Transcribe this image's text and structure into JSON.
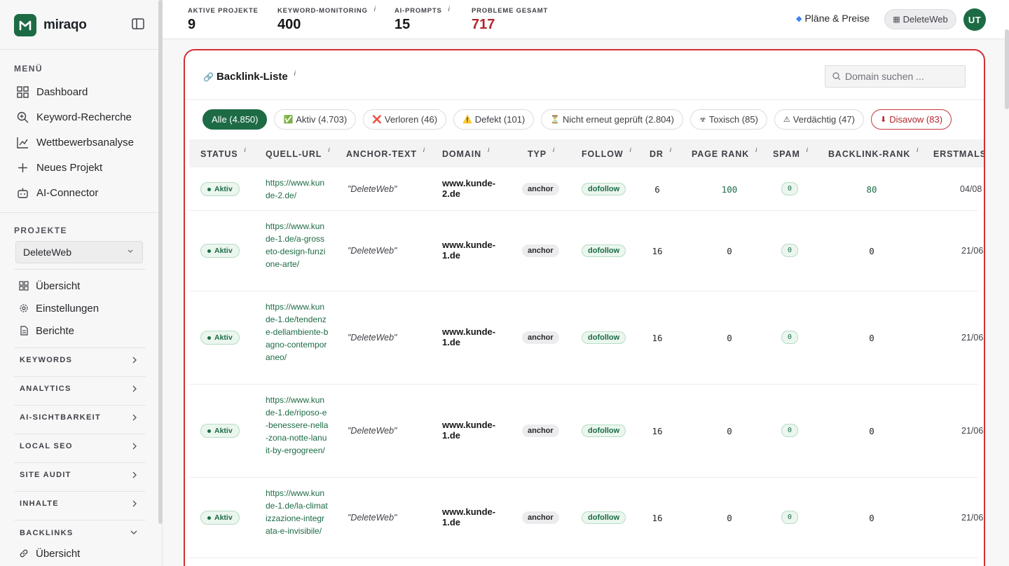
{
  "brand": {
    "name": "miraqo"
  },
  "sidebar": {
    "menu_heading": "MENÜ",
    "menu_items": [
      {
        "label": "Dashboard",
        "icon": "grid-icon"
      },
      {
        "label": "Keyword-Recherche",
        "icon": "search-plus-icon"
      },
      {
        "label": "Wettbewerbsanalyse",
        "icon": "chart-line-icon"
      },
      {
        "label": "Neues Projekt",
        "icon": "plus-icon"
      },
      {
        "label": "AI-Connector",
        "icon": "robot-icon"
      }
    ],
    "projects_heading": "PROJEKTE",
    "project_select": "DeleteWeb",
    "project_items": [
      {
        "label": "Übersicht",
        "icon": "grid-icon"
      },
      {
        "label": "Einstellungen",
        "icon": "gear-icon"
      },
      {
        "label": "Berichte",
        "icon": "document-icon"
      }
    ],
    "groups": [
      "KEYWORDS",
      "ANALYTICS",
      "AI-SICHTBARKEIT",
      "LOCAL SEO",
      "SITE AUDIT",
      "INHALTE",
      "BACKLINKS"
    ],
    "backlinks_sub": {
      "label": "Übersicht",
      "icon": "link-icon"
    }
  },
  "topbar": {
    "stats": [
      {
        "label": "AKTIVE PROJEKTE",
        "value": "9",
        "info": false
      },
      {
        "label": "KEYWORD-MONITORING",
        "value": "400",
        "info": true
      },
      {
        "label": "AI-PROMPTS",
        "value": "15",
        "info": true
      },
      {
        "label": "PROBLEME GESAMT",
        "value": "717",
        "info": false
      }
    ],
    "info_glyph": "i",
    "plans_label": "Pläne & Preise",
    "account_label": "DeleteWeb",
    "avatar_initials": "UT"
  },
  "card": {
    "title": "Backlink-Liste",
    "search_placeholder": "Domain suchen ...",
    "filters": [
      {
        "label": "Alle (4.850)",
        "emoji": "",
        "state": "active"
      },
      {
        "label": "Aktiv (4.703)",
        "emoji": "✅",
        "state": "normal"
      },
      {
        "label": "Verloren (46)",
        "emoji": "❌",
        "state": "normal"
      },
      {
        "label": "Defekt (101)",
        "emoji": "⚠️",
        "state": "normal"
      },
      {
        "label": "Nicht erneut geprüft (2.804)",
        "emoji": "⏳",
        "state": "normal"
      },
      {
        "label": "Toxisch (85)",
        "emoji": "☣",
        "state": "normal"
      },
      {
        "label": "Verdächtig (47)",
        "emoji": "⚠",
        "state": "normal"
      },
      {
        "label": "Disavow (83)",
        "emoji": "⬇",
        "state": "danger"
      }
    ],
    "columns": [
      "STATUS",
      "QUELL-URL",
      "ANCHOR-TEXT",
      "DOMAIN",
      "TYP",
      "FOLLOW",
      "DR",
      "PAGE RANK",
      "SPAM",
      "BACKLINK-RANK",
      "ERSTMALS"
    ],
    "rows": [
      {
        "status": "Aktiv",
        "url": "https://www.kunde-2.de/",
        "anchor": "\"DeleteWeb\"",
        "domain": "www.kunde-2.de",
        "typ": "anchor",
        "follow": "dofollow",
        "dr": "6",
        "page_rank": "100",
        "spam": "0",
        "backlink_rank": "80",
        "first_seen": "04/08"
      },
      {
        "status": "Aktiv",
        "url": "https://www.kunde-1.de/a-grosseto-design-funzione-arte/",
        "anchor": "\"DeleteWeb\"",
        "domain": "www.kunde-1.de",
        "typ": "anchor",
        "follow": "dofollow",
        "dr": "16",
        "page_rank": "0",
        "spam": "0",
        "backlink_rank": "0",
        "first_seen": "21/06"
      },
      {
        "status": "Aktiv",
        "url": "https://www.kunde-1.de/tendenze-dellambiente-bagno-contemporaneo/",
        "anchor": "\"DeleteWeb\"",
        "domain": "www.kunde-1.de",
        "typ": "anchor",
        "follow": "dofollow",
        "dr": "16",
        "page_rank": "0",
        "spam": "0",
        "backlink_rank": "0",
        "first_seen": "21/06"
      },
      {
        "status": "Aktiv",
        "url": "https://www.kunde-1.de/riposo-e-benessere-nella-zona-notte-lanuit-by-ergogreen/",
        "anchor": "\"DeleteWeb\"",
        "domain": "www.kunde-1.de",
        "typ": "anchor",
        "follow": "dofollow",
        "dr": "16",
        "page_rank": "0",
        "spam": "0",
        "backlink_rank": "0",
        "first_seen": "21/06"
      },
      {
        "status": "Aktiv",
        "url": "https://www.kunde-1.de/la-climatizzazione-integrata-e-invisibile/",
        "anchor": "\"DeleteWeb\"",
        "domain": "www.kunde-1.de",
        "typ": "anchor",
        "follow": "dofollow",
        "dr": "16",
        "page_rank": "0",
        "spam": "0",
        "backlink_rank": "0",
        "first_seen": "21/06"
      }
    ]
  },
  "colors": {
    "brand_green": "#1d6b45",
    "alert_red": "#b3262d",
    "card_border": "#d22f36"
  }
}
